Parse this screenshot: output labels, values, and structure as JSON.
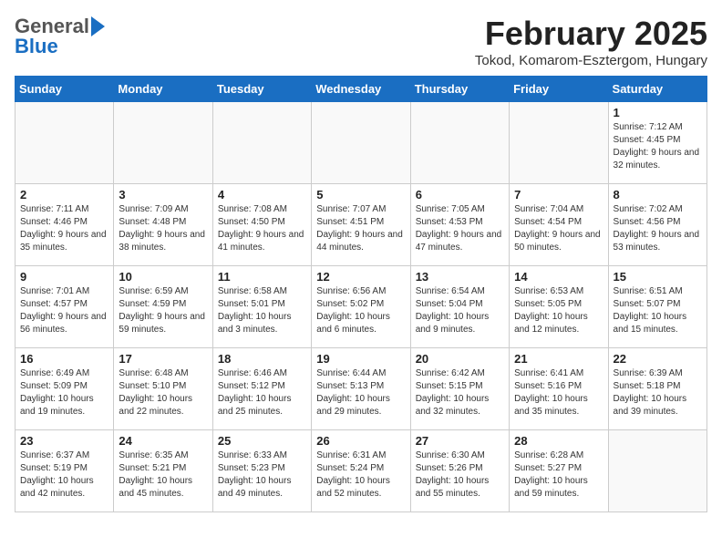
{
  "header": {
    "logo_general": "General",
    "logo_blue": "Blue",
    "month_title": "February 2025",
    "location": "Tokod, Komarom-Esztergom, Hungary"
  },
  "calendar": {
    "days_of_week": [
      "Sunday",
      "Monday",
      "Tuesday",
      "Wednesday",
      "Thursday",
      "Friday",
      "Saturday"
    ],
    "weeks": [
      [
        {
          "day": "",
          "detail": ""
        },
        {
          "day": "",
          "detail": ""
        },
        {
          "day": "",
          "detail": ""
        },
        {
          "day": "",
          "detail": ""
        },
        {
          "day": "",
          "detail": ""
        },
        {
          "day": "",
          "detail": ""
        },
        {
          "day": "1",
          "detail": "Sunrise: 7:12 AM\nSunset: 4:45 PM\nDaylight: 9 hours and 32 minutes."
        }
      ],
      [
        {
          "day": "2",
          "detail": "Sunrise: 7:11 AM\nSunset: 4:46 PM\nDaylight: 9 hours and 35 minutes."
        },
        {
          "day": "3",
          "detail": "Sunrise: 7:09 AM\nSunset: 4:48 PM\nDaylight: 9 hours and 38 minutes."
        },
        {
          "day": "4",
          "detail": "Sunrise: 7:08 AM\nSunset: 4:50 PM\nDaylight: 9 hours and 41 minutes."
        },
        {
          "day": "5",
          "detail": "Sunrise: 7:07 AM\nSunset: 4:51 PM\nDaylight: 9 hours and 44 minutes."
        },
        {
          "day": "6",
          "detail": "Sunrise: 7:05 AM\nSunset: 4:53 PM\nDaylight: 9 hours and 47 minutes."
        },
        {
          "day": "7",
          "detail": "Sunrise: 7:04 AM\nSunset: 4:54 PM\nDaylight: 9 hours and 50 minutes."
        },
        {
          "day": "8",
          "detail": "Sunrise: 7:02 AM\nSunset: 4:56 PM\nDaylight: 9 hours and 53 minutes."
        }
      ],
      [
        {
          "day": "9",
          "detail": "Sunrise: 7:01 AM\nSunset: 4:57 PM\nDaylight: 9 hours and 56 minutes."
        },
        {
          "day": "10",
          "detail": "Sunrise: 6:59 AM\nSunset: 4:59 PM\nDaylight: 9 hours and 59 minutes."
        },
        {
          "day": "11",
          "detail": "Sunrise: 6:58 AM\nSunset: 5:01 PM\nDaylight: 10 hours and 3 minutes."
        },
        {
          "day": "12",
          "detail": "Sunrise: 6:56 AM\nSunset: 5:02 PM\nDaylight: 10 hours and 6 minutes."
        },
        {
          "day": "13",
          "detail": "Sunrise: 6:54 AM\nSunset: 5:04 PM\nDaylight: 10 hours and 9 minutes."
        },
        {
          "day": "14",
          "detail": "Sunrise: 6:53 AM\nSunset: 5:05 PM\nDaylight: 10 hours and 12 minutes."
        },
        {
          "day": "15",
          "detail": "Sunrise: 6:51 AM\nSunset: 5:07 PM\nDaylight: 10 hours and 15 minutes."
        }
      ],
      [
        {
          "day": "16",
          "detail": "Sunrise: 6:49 AM\nSunset: 5:09 PM\nDaylight: 10 hours and 19 minutes."
        },
        {
          "day": "17",
          "detail": "Sunrise: 6:48 AM\nSunset: 5:10 PM\nDaylight: 10 hours and 22 minutes."
        },
        {
          "day": "18",
          "detail": "Sunrise: 6:46 AM\nSunset: 5:12 PM\nDaylight: 10 hours and 25 minutes."
        },
        {
          "day": "19",
          "detail": "Sunrise: 6:44 AM\nSunset: 5:13 PM\nDaylight: 10 hours and 29 minutes."
        },
        {
          "day": "20",
          "detail": "Sunrise: 6:42 AM\nSunset: 5:15 PM\nDaylight: 10 hours and 32 minutes."
        },
        {
          "day": "21",
          "detail": "Sunrise: 6:41 AM\nSunset: 5:16 PM\nDaylight: 10 hours and 35 minutes."
        },
        {
          "day": "22",
          "detail": "Sunrise: 6:39 AM\nSunset: 5:18 PM\nDaylight: 10 hours and 39 minutes."
        }
      ],
      [
        {
          "day": "23",
          "detail": "Sunrise: 6:37 AM\nSunset: 5:19 PM\nDaylight: 10 hours and 42 minutes."
        },
        {
          "day": "24",
          "detail": "Sunrise: 6:35 AM\nSunset: 5:21 PM\nDaylight: 10 hours and 45 minutes."
        },
        {
          "day": "25",
          "detail": "Sunrise: 6:33 AM\nSunset: 5:23 PM\nDaylight: 10 hours and 49 minutes."
        },
        {
          "day": "26",
          "detail": "Sunrise: 6:31 AM\nSunset: 5:24 PM\nDaylight: 10 hours and 52 minutes."
        },
        {
          "day": "27",
          "detail": "Sunrise: 6:30 AM\nSunset: 5:26 PM\nDaylight: 10 hours and 55 minutes."
        },
        {
          "day": "28",
          "detail": "Sunrise: 6:28 AM\nSunset: 5:27 PM\nDaylight: 10 hours and 59 minutes."
        },
        {
          "day": "",
          "detail": ""
        }
      ]
    ]
  }
}
